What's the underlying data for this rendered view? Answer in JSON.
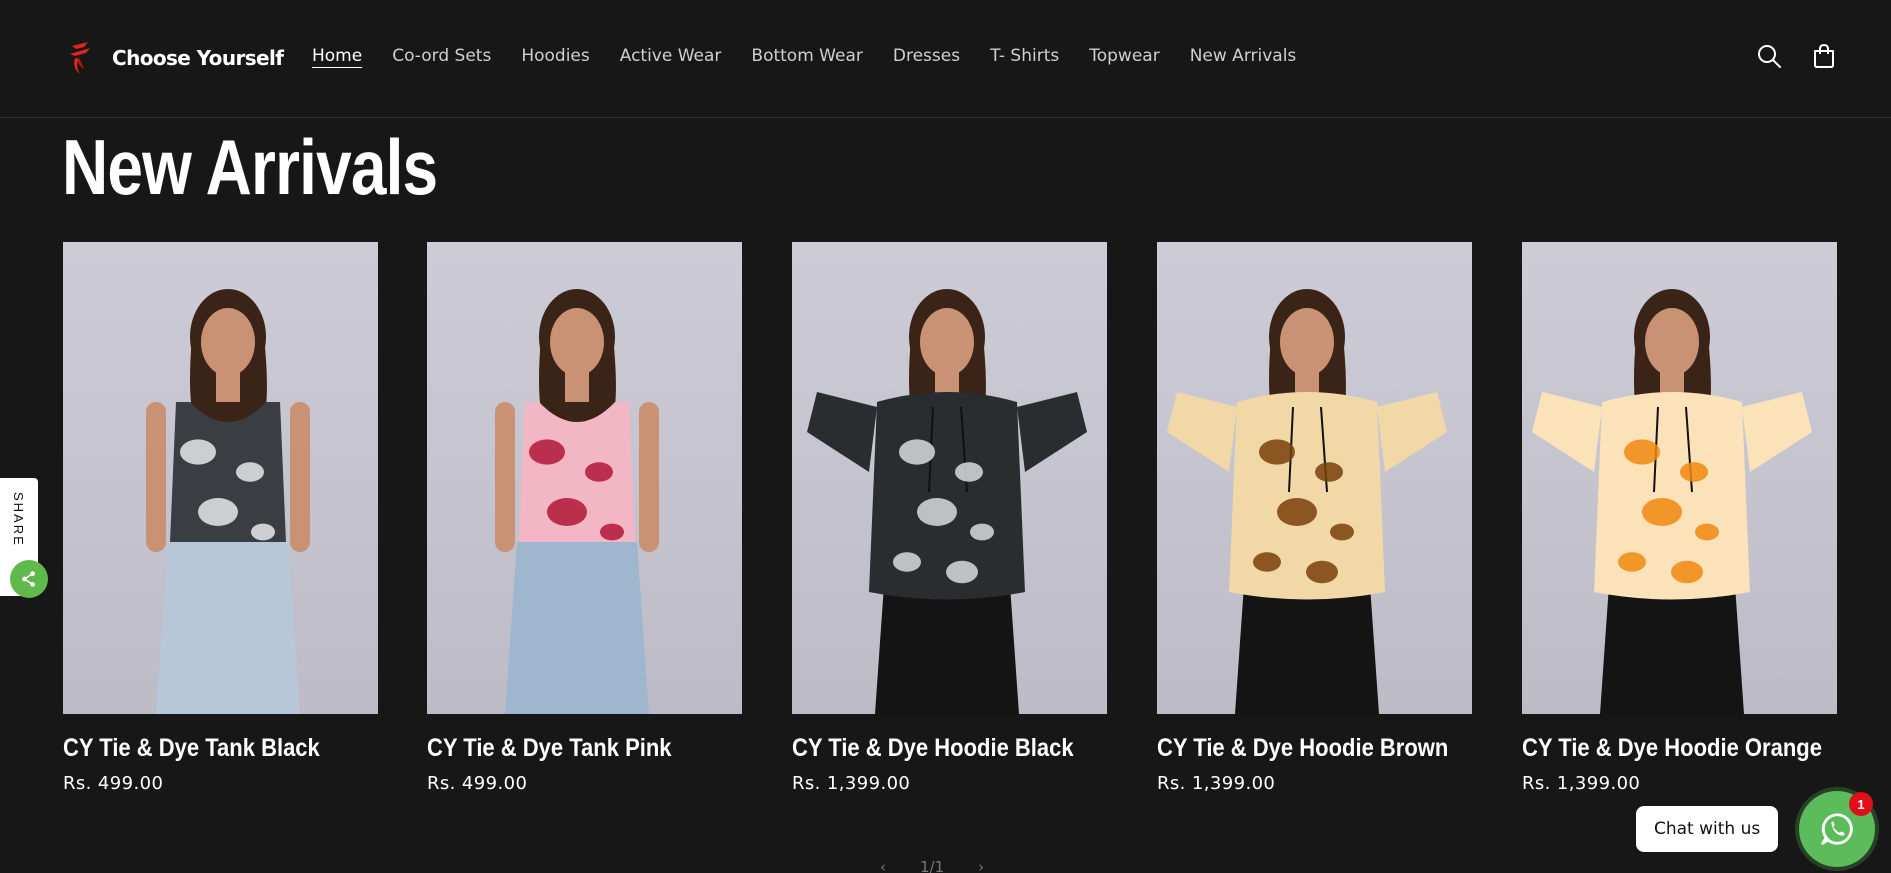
{
  "brand": {
    "name": "Choose Yourself",
    "accent": "#e0251b"
  },
  "nav": [
    {
      "label": "Home",
      "active": true
    },
    {
      "label": "Co-ord Sets"
    },
    {
      "label": "Hoodies"
    },
    {
      "label": "Active Wear"
    },
    {
      "label": "Bottom Wear"
    },
    {
      "label": "Dresses"
    },
    {
      "label": "T- Shirts"
    },
    {
      "label": "Topwear"
    },
    {
      "label": "New Arrivals"
    }
  ],
  "header_icons": {
    "search": "search-icon",
    "cart": "cart-icon"
  },
  "page": {
    "title": "New Arrivals"
  },
  "products": [
    {
      "title": "CY Tie & Dye Tank Black",
      "price": "Rs. 499.00",
      "colors": {
        "top": "#3a3d42",
        "dye": "#e6e7ea",
        "bottom": "#b8c7d8"
      }
    },
    {
      "title": "CY Tie & Dye Tank Pink",
      "price": "Rs. 499.00",
      "colors": {
        "top": "#f3b6c4",
        "dye": "#b0163a",
        "bottom": "#9fb6cf"
      }
    },
    {
      "title": "CY Tie & Dye Hoodie Black",
      "price": "Rs. 1,399.00",
      "colors": {
        "top": "#2a2d30",
        "dye": "#d8dbde",
        "bottom": "#141414"
      }
    },
    {
      "title": "CY Tie & Dye Hoodie Brown",
      "price": "Rs. 1,399.00",
      "colors": {
        "top": "#f1d8a6",
        "dye": "#7a3f0c",
        "bottom": "#141414"
      }
    },
    {
      "title": "CY Tie & Dye Hoodie Orange",
      "price": "Rs. 1,399.00",
      "colors": {
        "top": "#fbe2b8",
        "dye": "#f0880f",
        "bottom": "#141414"
      }
    }
  ],
  "share": {
    "label": "SHARE",
    "color": "#5fb94c"
  },
  "pagination": {
    "prev": "‹",
    "label": "1/1",
    "next": "›"
  },
  "chat": {
    "label": "Chat with us",
    "badge": "1",
    "color": "#5cbb5a"
  }
}
